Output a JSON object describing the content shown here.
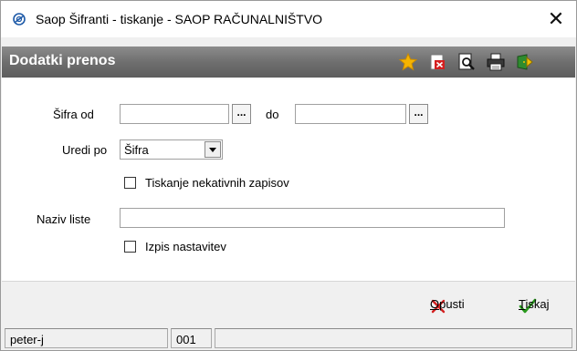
{
  "window": {
    "title": "Saop Šifranti - tiskanje - SAOP RAČUNALNIŠTVO",
    "close_glyph": "✕"
  },
  "header": {
    "title": "Dodatki prenos",
    "toolbar": [
      "star-icon",
      "pdf-export-icon",
      "print-preview-icon",
      "printer-icon",
      "exit-icon"
    ]
  },
  "form": {
    "sifra_od_label": "Šifra od",
    "sifra_od_value": "",
    "do_label": "do",
    "do_value": "",
    "ellipsis_label": "...",
    "uredi_po_label": "Uredi po",
    "uredi_po_value": "Šifra",
    "tiskanje_label": "Tiskanje nekativnih zapisov",
    "tiskanje_checked": false,
    "naziv_liste_label": "Naziv liste",
    "naziv_liste_value": "",
    "izpis_label": "Izpis nastavitev",
    "izpis_checked": false
  },
  "footer": {
    "cancel_label_rest": "pusti",
    "cancel_label_first": "O",
    "print_label_first": "T",
    "print_label_rest": "iskaj"
  },
  "status": {
    "user": "peter-j",
    "code": "001",
    "message": ""
  },
  "colors": {
    "header_gradient_top": "#8c8c8c",
    "header_gradient_bottom": "#5e5e5e",
    "cancel_red": "#d42020",
    "print_green": "#2a9a1e",
    "star_yellow": "#f5b400"
  }
}
